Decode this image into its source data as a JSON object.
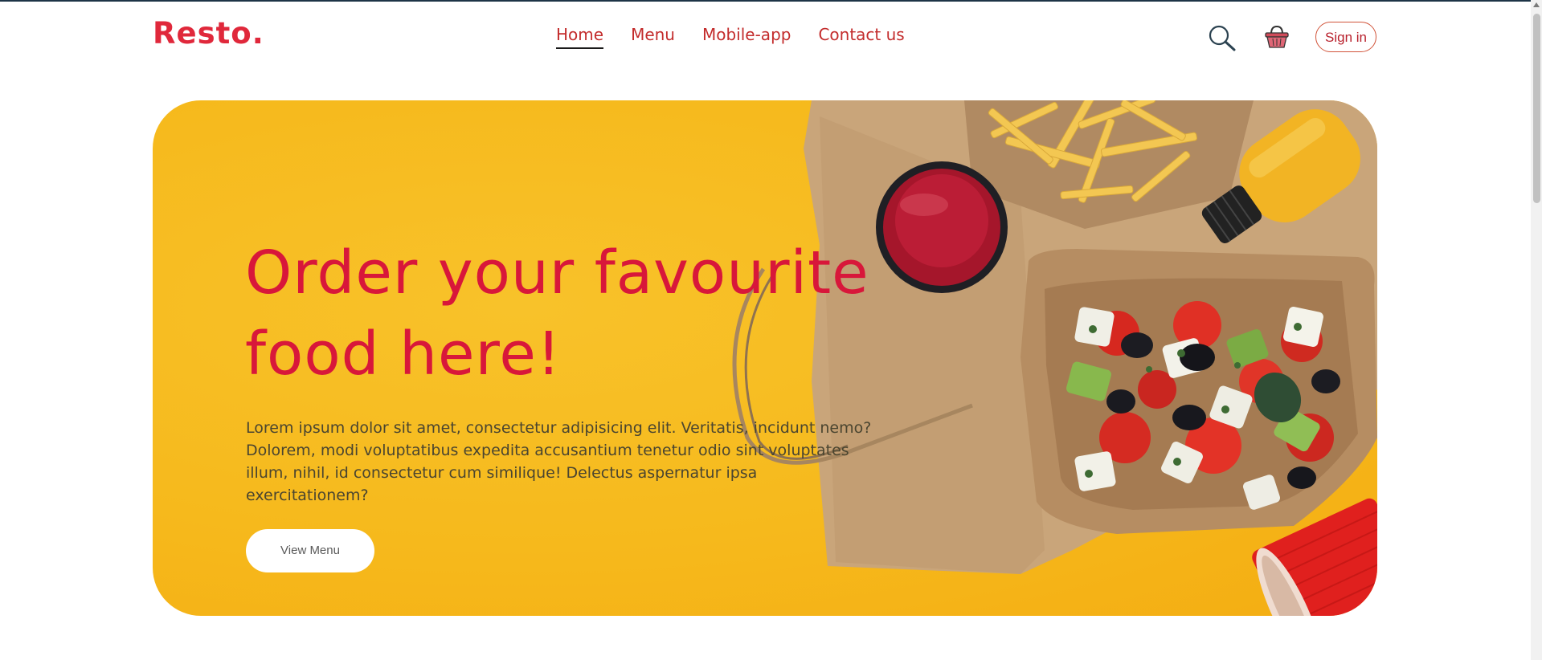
{
  "header": {
    "logo": "Resto.",
    "nav": [
      {
        "label": "Home",
        "active": true
      },
      {
        "label": "Menu",
        "active": false
      },
      {
        "label": "Mobile-app",
        "active": false
      },
      {
        "label": "Contact us",
        "active": false
      }
    ],
    "icons": [
      "search-icon",
      "basket-icon"
    ],
    "signin_label": "Sign in"
  },
  "hero": {
    "title_line1": "Order your favourite",
    "title_line2": "food here!",
    "description": "Lorem ipsum dolor sit amet, consectetur adipisicing elit. Veritatis, incidunt nemo? Dolorem, modi voluptatibus expedita accusantium tenetur odio sint voluptates illum, nihil, id consectetur cum similique! Delectus aspernatur ipsa exercitationem?",
    "button_label": "View Menu",
    "image": "food-delivery-photo"
  },
  "colors": {
    "brand": "#e0283b",
    "nav_text": "#c32c2c",
    "hero_bg": "#f6b91c",
    "title": "#d8173a"
  }
}
